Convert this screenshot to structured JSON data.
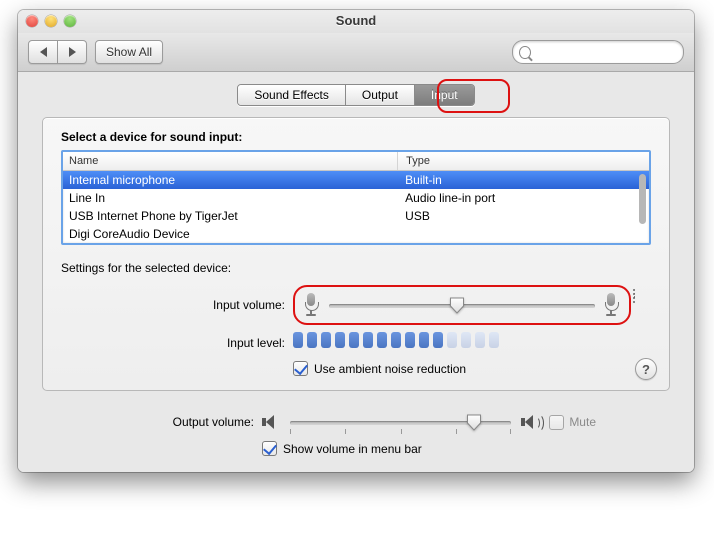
{
  "window": {
    "title": "Sound"
  },
  "toolbar": {
    "show_all": "Show All",
    "search_placeholder": ""
  },
  "tabs": {
    "items": [
      {
        "label": "Sound Effects",
        "selected": false
      },
      {
        "label": "Output",
        "selected": false
      },
      {
        "label": "Input",
        "selected": true
      }
    ]
  },
  "panel": {
    "select_device_label": "Select a device for sound input:",
    "columns": {
      "name": "Name",
      "type": "Type"
    },
    "devices": [
      {
        "name": "Internal microphone",
        "type": "Built-in",
        "selected": true
      },
      {
        "name": "Line In",
        "type": "Audio line-in port",
        "selected": false
      },
      {
        "name": "USB Internet Phone by TigerJet",
        "type": "USB",
        "selected": false
      },
      {
        "name": "Digi CoreAudio Device",
        "type": "",
        "selected": false
      }
    ],
    "settings_label": "Settings for the selected device:",
    "input_volume_label": "Input volume:",
    "input_volume_value": 0.48,
    "input_level_label": "Input level:",
    "input_level_segments_on": 11,
    "input_level_segments_total": 15,
    "ambient_label": "Use ambient noise reduction",
    "ambient_checked": true
  },
  "bottom": {
    "output_volume_label": "Output volume:",
    "output_volume_value": 0.83,
    "mute_label": "Mute",
    "mute_checked": false,
    "show_menu_label": "Show volume in menu bar",
    "show_menu_checked": true
  },
  "help_label": "?",
  "annotations": {
    "input_tab_highlighted": true,
    "input_volume_highlighted": true
  }
}
